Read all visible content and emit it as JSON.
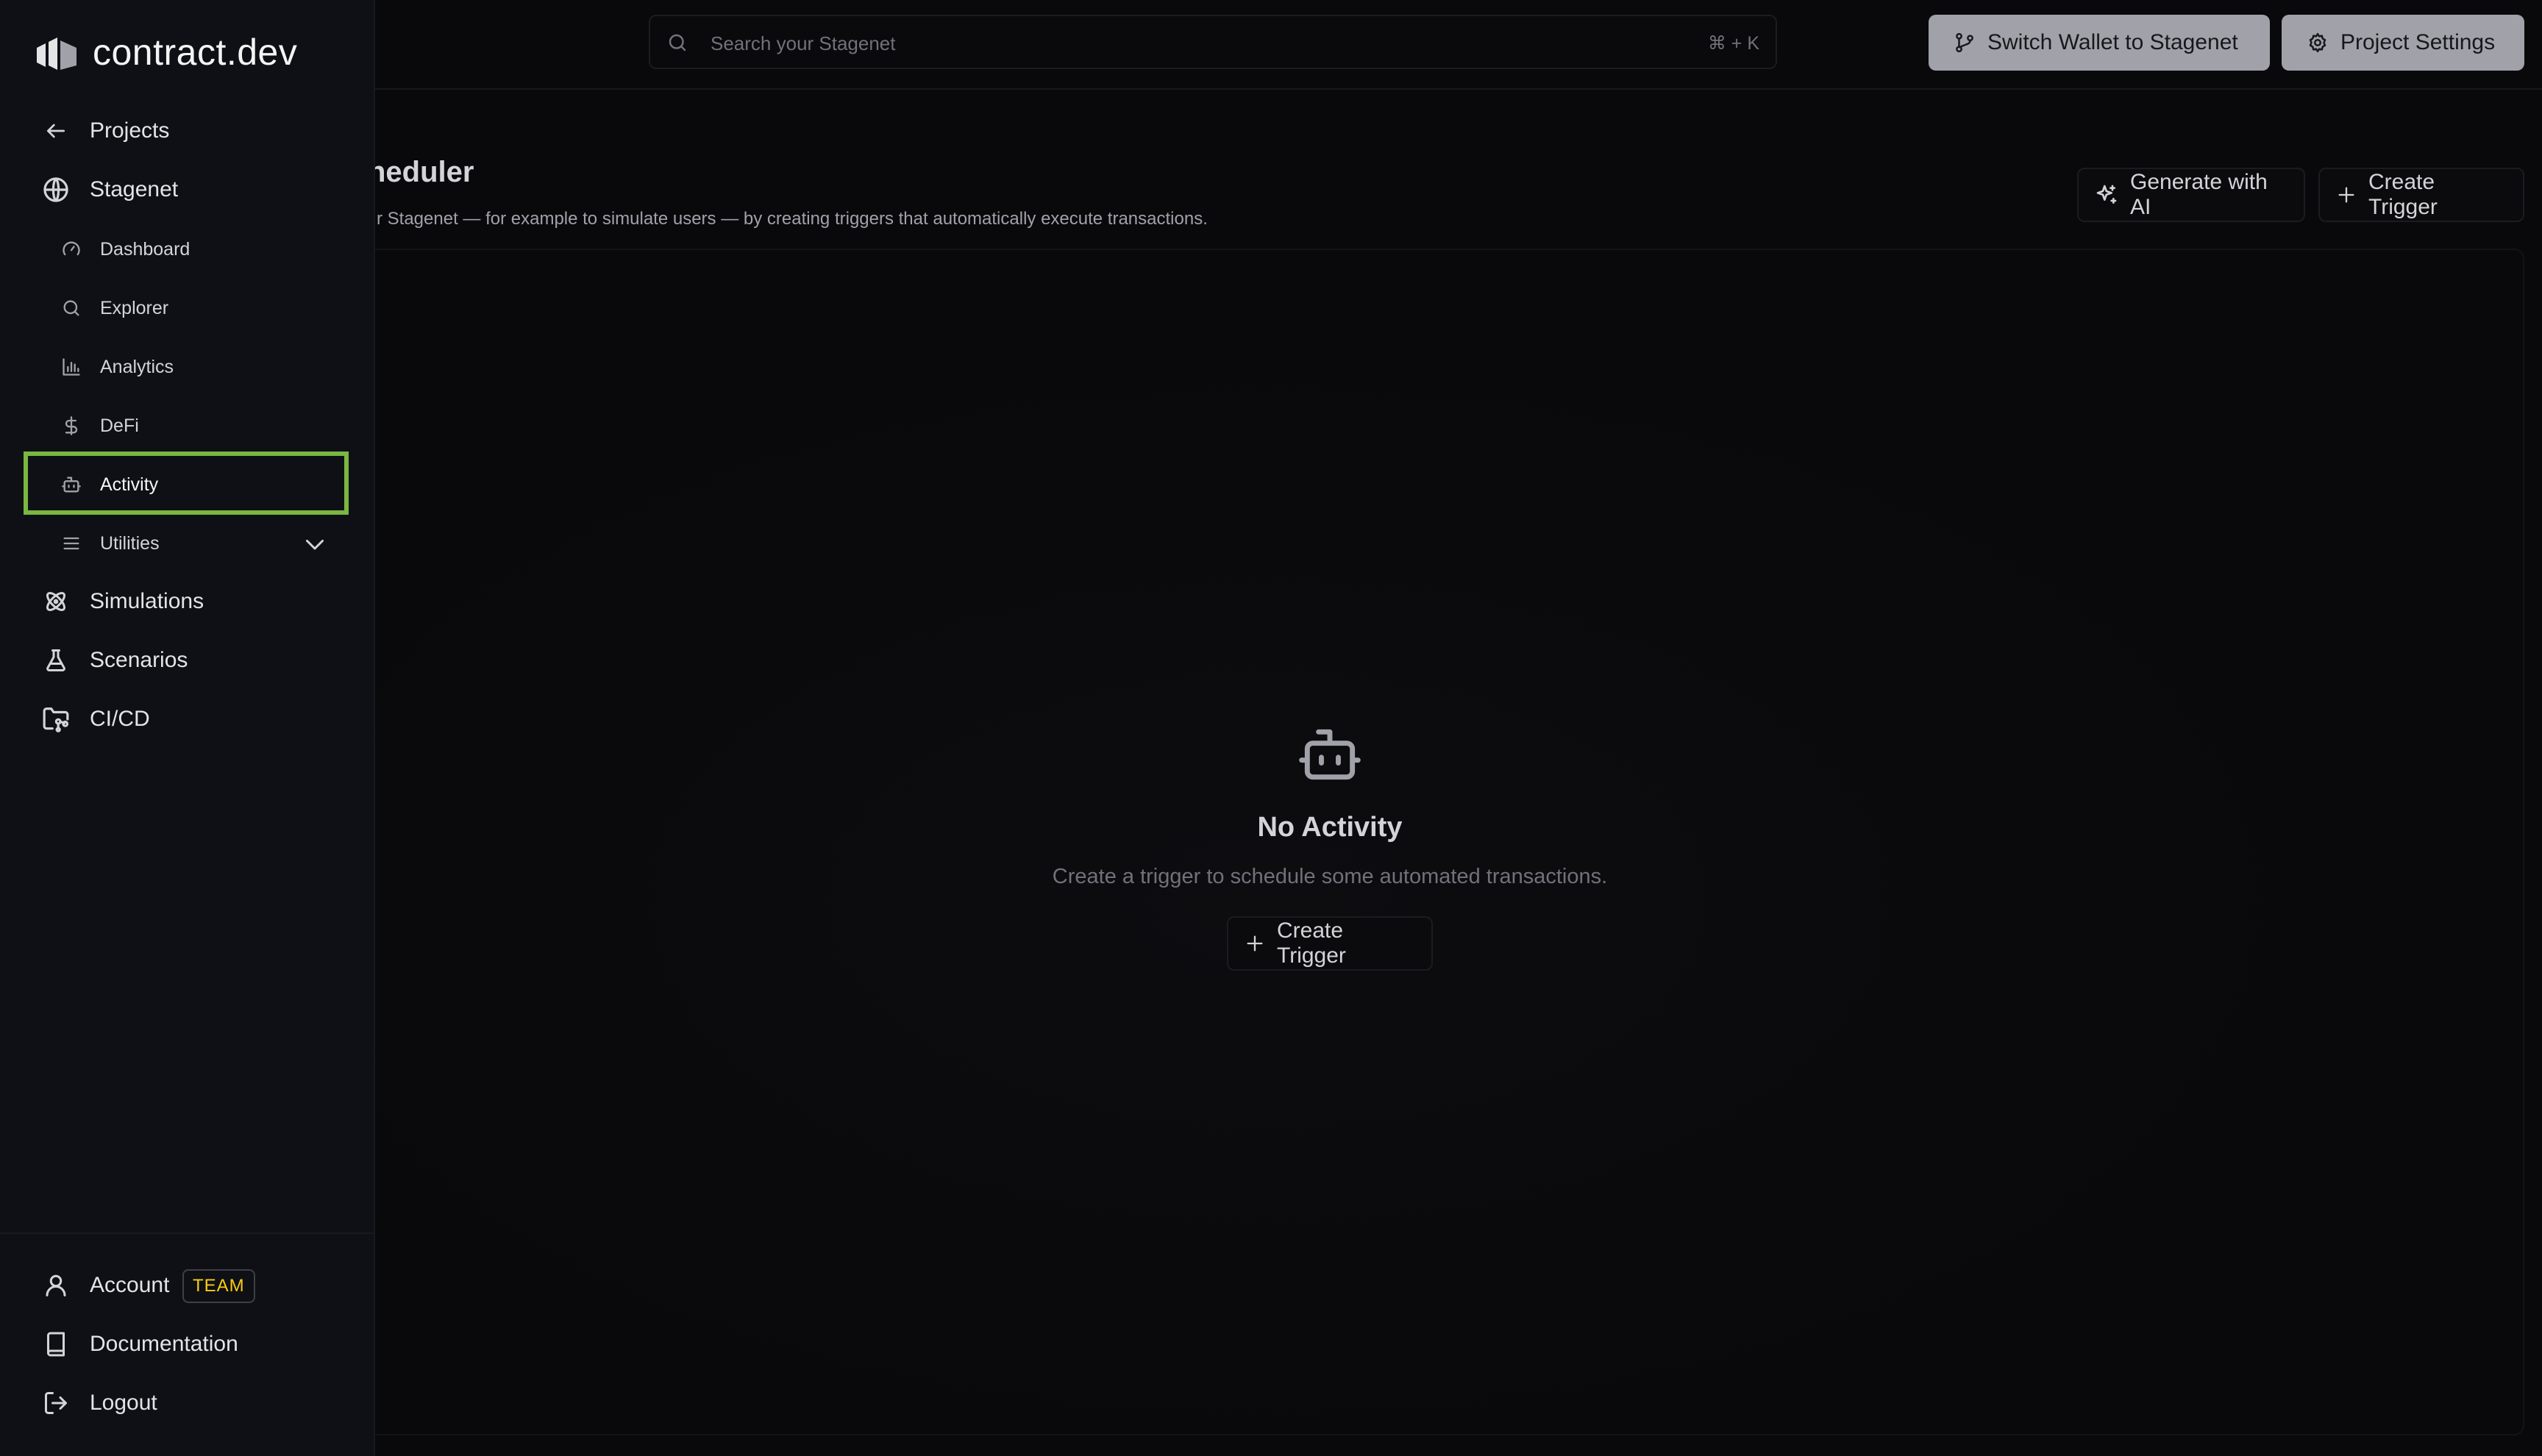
{
  "app": {
    "name": "contract.dev"
  },
  "search": {
    "placeholder": "Search your Stagenet",
    "shortcut": "⌘ + K"
  },
  "header": {
    "switch_wallet_label": "Switch Wallet to Stagenet",
    "settings_label": "Project Settings"
  },
  "page": {
    "title": "heduler",
    "subtitle": "r Stagenet — for example to simulate users — by creating triggers that automatically execute transactions.",
    "generate_ai_label": "Generate with AI",
    "create_trigger_label": "Create Trigger"
  },
  "empty_state": {
    "icon": "bot-icon",
    "title": "No Activity",
    "description": "Create a trigger to schedule some automated transactions.",
    "button_label": "Create Trigger"
  },
  "sidebar": {
    "back": {
      "label": "Projects",
      "icon": "arrow-left-icon"
    },
    "network": {
      "label": "Stagenet",
      "icon": "globe-icon"
    },
    "items": [
      {
        "label": "Dashboard",
        "icon": "gauge-icon"
      },
      {
        "label": "Explorer",
        "icon": "search-icon"
      },
      {
        "label": "Analytics",
        "icon": "bar-chart-icon"
      },
      {
        "label": "DeFi",
        "icon": "dollar-icon"
      },
      {
        "label": "Activity",
        "icon": "bot-icon",
        "active": true
      },
      {
        "label": "Utilities",
        "icon": "menu-icon"
      }
    ],
    "sections": [
      {
        "label": "Simulations",
        "icon": "atom-icon"
      },
      {
        "label": "Scenarios",
        "icon": "flask-icon"
      },
      {
        "label": "CI/CD",
        "icon": "folder-git-icon"
      }
    ],
    "footer": {
      "account_label": "Account",
      "team_badge": "TEAM",
      "documentation_label": "Documentation",
      "logout_label": "Logout"
    }
  },
  "colors": {
    "background": "#09090b",
    "sidebar": "#0e1015",
    "highlight": "#7ab641",
    "badge": "#facc15",
    "primary_button": "#a1a1aa"
  }
}
